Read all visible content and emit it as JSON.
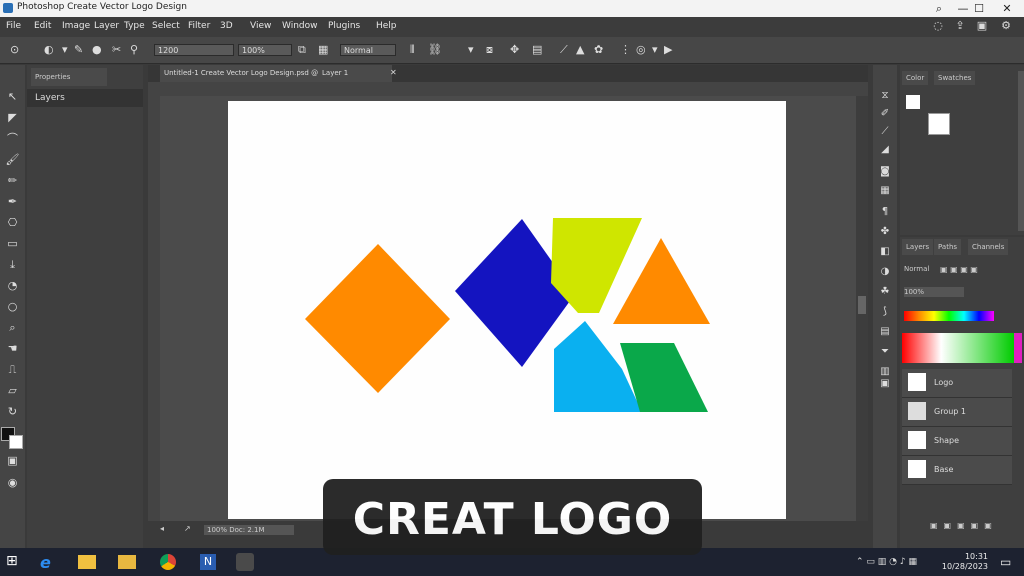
{
  "window": {
    "title": "Photoshop Create Vector Logo Design",
    "controls": [
      "minimize",
      "maximize",
      "close"
    ]
  },
  "menu": [
    "File",
    "Edit",
    "Image",
    "Layer",
    "Type",
    "Select",
    "Filter",
    "3D",
    "View",
    "Window",
    "Plugins",
    "Help"
  ],
  "options_bar": {
    "preset_value": "1200",
    "size_value": "100%",
    "mode_label": "Normal"
  },
  "left_panel": {
    "tab": "Properties",
    "header": "Layers"
  },
  "document_tabs": [
    "Untitled-1 Create Vector Logo Design.psd @ 100%",
    "Layer 1"
  ],
  "status": {
    "zoom_label": "100% Doc: 2.1M"
  },
  "right_panel_top": {
    "tabs": [
      "Color",
      "Swatches"
    ]
  },
  "right_panel_bottom": {
    "tabs": [
      "Layers",
      "Paths",
      "Channels"
    ],
    "blend_mode": "Normal",
    "opacity": "100%",
    "layers": [
      "Logo",
      "Group 1",
      "Shape",
      "Base"
    ]
  },
  "taskbar": {
    "time": "10:31",
    "date": "10/28/2023"
  },
  "banner": {
    "text": "CREAT LOGO"
  },
  "colors": {
    "orange": "#ff8a00",
    "blue": "#1414c0",
    "lime": "#cfe600",
    "cyan": "#0ab0f0",
    "green": "#0aa84a"
  }
}
